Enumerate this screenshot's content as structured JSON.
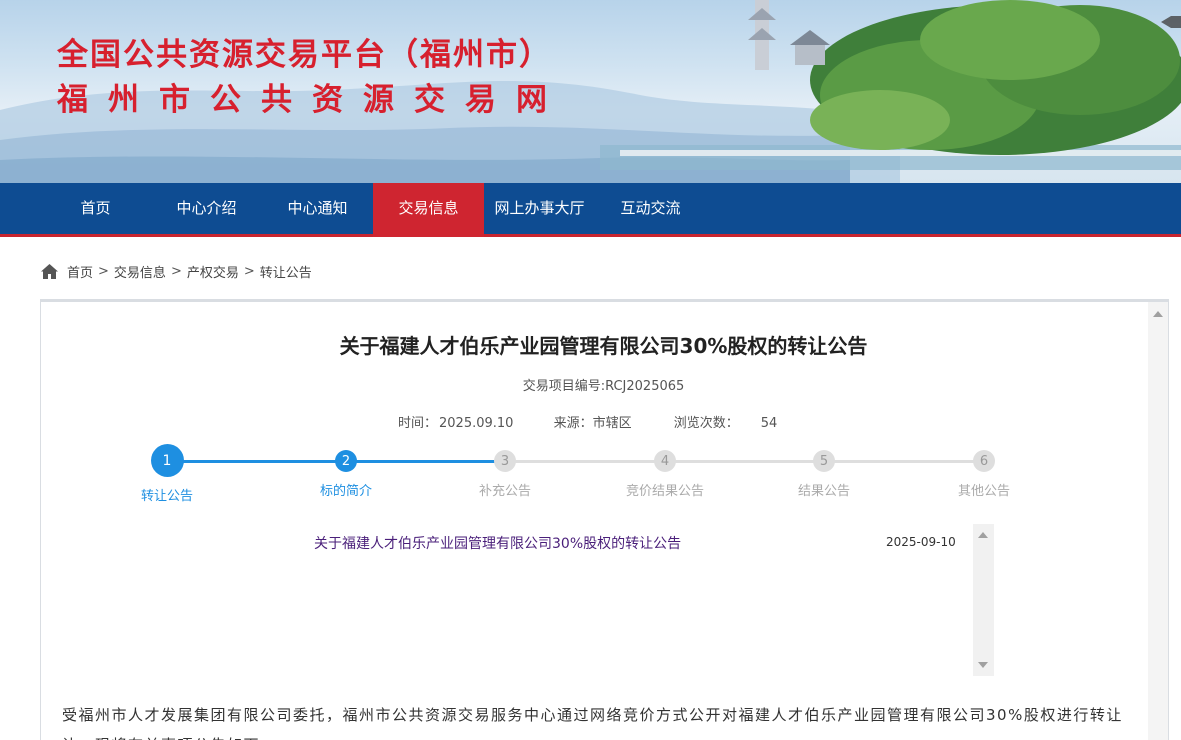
{
  "banner": {
    "title_line1": "全国公共资源交易平台（福州市）",
    "title_line2": "福州市公共资源交易网"
  },
  "nav": {
    "items": [
      {
        "label": "首页"
      },
      {
        "label": "中心介绍"
      },
      {
        "label": "中心通知"
      },
      {
        "label": "交易信息",
        "active": true
      },
      {
        "label": "网上办事大厅"
      },
      {
        "label": "互动交流"
      }
    ]
  },
  "breadcrumb": {
    "items": [
      "首页",
      "交易信息",
      "产权交易",
      "转让公告"
    ],
    "separator": ">"
  },
  "article": {
    "title": "关于福建人才伯乐产业园管理有限公司30%股权的转让公告",
    "project_code": "交易项目编号:RCJ2025065",
    "time_label": "时间：",
    "time_value": "2025.09.10",
    "source_label": "来源：",
    "source_value": "市辖区",
    "views_label": "浏览次数：",
    "views_value": "54",
    "body_line1": "受福州市人才发展集团有限公司委托，福州市公共资源交易服务中心通过网络竞价方式公开对福建人才伯乐产业园管理有限公司30%股权进行转让",
    "body_line2": "让，现将有关事项公告如下："
  },
  "steps": [
    {
      "number": "1",
      "label": "转让公告",
      "state": "done"
    },
    {
      "number": "2",
      "label": "标的简介",
      "state": "done"
    },
    {
      "number": "3",
      "label": "补充公告",
      "state": "todo"
    },
    {
      "number": "4",
      "label": "竞价结果公告",
      "state": "todo"
    },
    {
      "number": "5",
      "label": "结果公告",
      "state": "todo"
    },
    {
      "number": "6",
      "label": "其他公告",
      "state": "todo"
    }
  ],
  "announcement_list": [
    {
      "title": "关于福建人才伯乐产业园管理有限公司30%股权的转让公告",
      "date": "2025-09-10"
    }
  ],
  "colors": {
    "nav_bg": "#0e4c92",
    "nav_active": "#cf2530",
    "banner_title": "#d7202e",
    "step_active": "#1e8fe1",
    "step_inactive": "#dedede"
  }
}
